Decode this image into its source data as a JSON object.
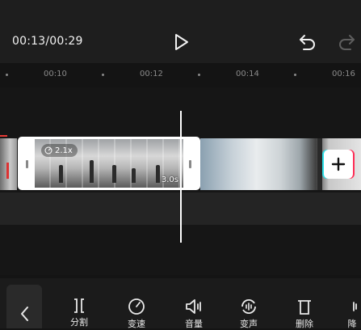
{
  "player": {
    "timecode": "00:13/00:29",
    "play_icon": "play-icon",
    "undo_icon": "undo-icon",
    "redo_icon": "redo-icon"
  },
  "ruler": {
    "labels": [
      "00:10",
      "00:12",
      "00:14",
      "00:16"
    ]
  },
  "timeline": {
    "selected_clip": {
      "speed_badge": "2.1x",
      "duration": "3.0s"
    },
    "add_clip_icon": "plus-icon"
  },
  "toolbar": {
    "back_icon": "chevron-left-icon",
    "items": [
      {
        "label": "分割",
        "icon": "split-icon"
      },
      {
        "label": "变速",
        "icon": "speed-dial-icon"
      },
      {
        "label": "音量",
        "icon": "volume-icon"
      },
      {
        "label": "变声",
        "icon": "voice-change-icon"
      },
      {
        "label": "删除",
        "icon": "delete-icon"
      },
      {
        "label": "降",
        "icon": "noise-icon"
      }
    ]
  },
  "colors": {
    "background": "#141414",
    "accent_cyan": "#2ce0e8",
    "accent_pink": "#ff2d55",
    "playhead": "#ffffff"
  }
}
